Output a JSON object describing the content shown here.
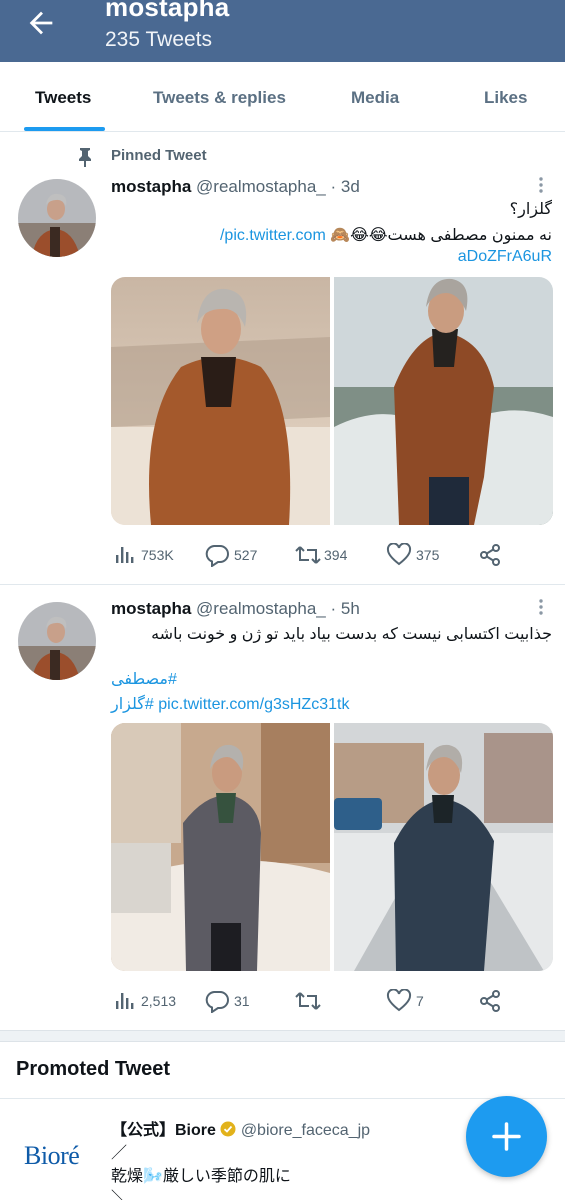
{
  "header": {
    "name": "mostapha",
    "tweet_count": "235 Tweets"
  },
  "tabs": [
    {
      "label": "Tweets",
      "active": true
    },
    {
      "label": "Tweets & replies",
      "active": false
    },
    {
      "label": "Media",
      "active": false
    },
    {
      "label": "Likes",
      "active": false
    }
  ],
  "tweets": [
    {
      "pinned_label": "Pinned Tweet",
      "name": "mostapha",
      "handle": "@realmostapha_",
      "time": "· 3d",
      "text_line1": "گلزار؟",
      "text_line2_text": "نه ممنون مصطفی هست😂😂🙈",
      "text_line2_link": "pic.twitter.com/",
      "text_line3_link": "aDoZFrA6uR",
      "stats": {
        "views": "753K",
        "replies": "527",
        "retweets": "394",
        "likes": "375"
      }
    },
    {
      "name": "mostapha",
      "handle": "@realmostapha_",
      "time": "· 5h",
      "text_line1": "جذابیت اکتسابی نیست که بدست بیاد باید تو ژن و خونت باشه",
      "hashtag1": "#مصطفی",
      "hashtag2": "#گلزار",
      "link": "pic.twitter.com/g3sHZc31tk",
      "stats": {
        "views": "2,513",
        "replies": "31",
        "retweets": "",
        "likes": "7"
      }
    }
  ],
  "promoted": {
    "section_title": "Promoted Tweet",
    "logo_text": "Bioré",
    "name": "【公式】Biore",
    "handle": "@biore_faceca_jp",
    "line1": "／",
    "line2": "乾燥🌬️厳しい季節の肌に",
    "line3": "＼"
  },
  "colors": {
    "header_bg": "#4a6992",
    "accent": "#1d9bf0",
    "link": "#1b95e0",
    "muted": "#536471"
  },
  "icons": [
    "back-arrow-icon",
    "pin-icon",
    "more-icon",
    "views-icon",
    "reply-icon",
    "retweet-icon",
    "like-icon",
    "share-icon",
    "verified-icon",
    "compose-plus-icon"
  ]
}
